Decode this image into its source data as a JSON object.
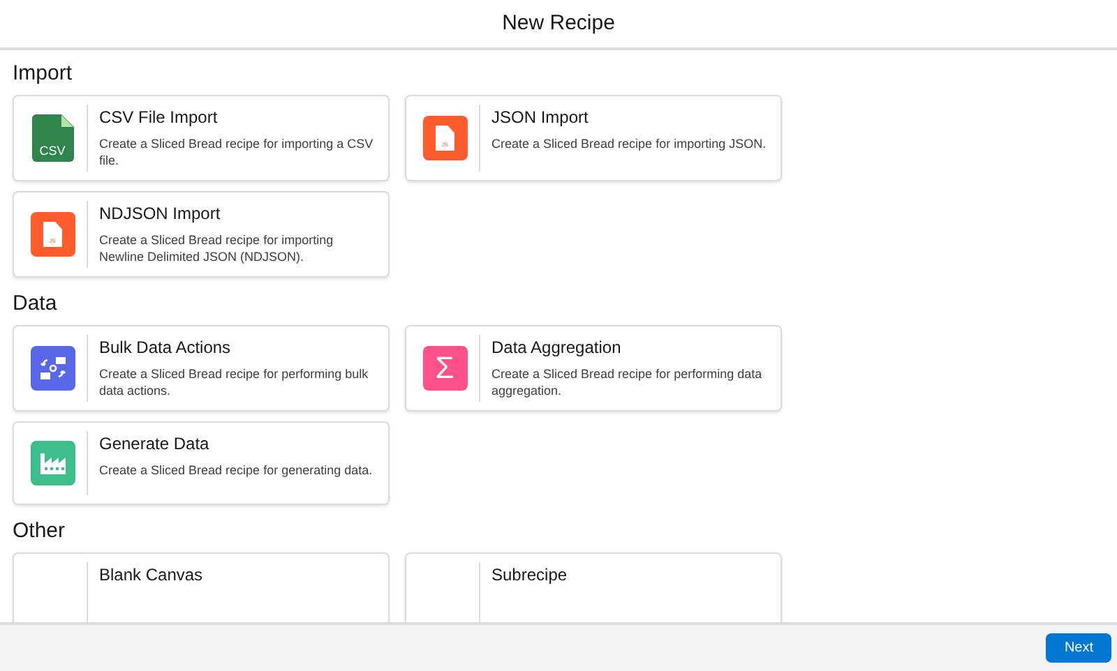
{
  "window": {
    "title": "New Recipe"
  },
  "sections": [
    {
      "heading": "Import",
      "cards": [
        {
          "title": "CSV File Import",
          "description": "Create a Sliced Bread recipe for importing a CSV file.",
          "icon": {
            "kind": "csv",
            "label": "CSV",
            "color": "#2e844a"
          }
        },
        {
          "title": "JSON Import",
          "description": "Create a Sliced Bread recipe for importing JSON.",
          "icon": {
            "kind": "file",
            "label": "JS",
            "color": "#fe5c2c"
          }
        },
        {
          "title": "NDJSON Import",
          "description": "Create a Sliced Bread recipe for importing Newline Delimited JSON (NDJSON).",
          "icon": {
            "kind": "file",
            "label": "JS",
            "color": "#fe5c2c"
          }
        }
      ]
    },
    {
      "heading": "Data",
      "cards": [
        {
          "title": "Bulk Data Actions",
          "description": "Create a Sliced Bread recipe for performing bulk data actions.",
          "icon": {
            "kind": "bulk",
            "color": "#5867e8"
          }
        },
        {
          "title": "Data Aggregation",
          "description": "Create a Sliced Bread recipe for performing data aggregation.",
          "icon": {
            "kind": "sigma",
            "label": "Σ",
            "color": "#fe5189"
          }
        },
        {
          "title": "Generate Data",
          "description": "Create a Sliced Bread recipe for generating data.",
          "icon": {
            "kind": "factory",
            "color": "#3ebd8c"
          }
        }
      ]
    },
    {
      "heading": "Other",
      "cards": [
        {
          "title": "Blank Canvas"
        },
        {
          "title": "Subrecipe"
        }
      ]
    }
  ],
  "footer": {
    "button": "Next"
  }
}
